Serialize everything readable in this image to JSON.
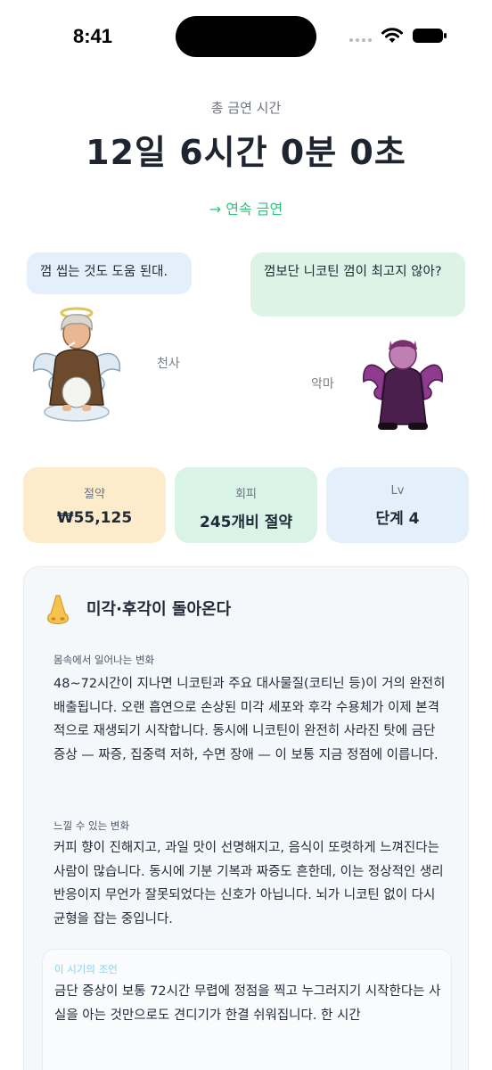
{
  "status_bar": {
    "time": "8:41"
  },
  "header": {
    "total_label": "총 금연 시간",
    "total_time": "12일 6시간 0분 0초",
    "streak_link": "→ 연속 금연"
  },
  "characters": {
    "angel": {
      "message": "껌 씹는 것도 도움 된대.",
      "label": "천사"
    },
    "devil": {
      "message": "껌보단 니코틴 껌이 최고지 않아?",
      "label": "악마"
    }
  },
  "stats": [
    {
      "title": "절약",
      "value": "₩55,125"
    },
    {
      "title": "회피",
      "value": "245개비 절약"
    },
    {
      "title": "Lv",
      "value": "단계 4"
    }
  ],
  "info": {
    "icon": "nose-icon",
    "title": "미각·후각이 돌아온다",
    "body_label": "몸속에서 일어나는 변화",
    "body_text": "48~72시간이 지나면 니코틴과 주요 대사물질(코티닌 등)이 거의 완전히 배출됩니다. 오랜 흡연으로 손상된 미각 세포와 후각 수용체가 이제 본격적으로 재생되기 시작합니다. 동시에 니코틴이 완전히 사라진 탓에 금단 증상 — 짜증, 집중력 저하, 수면 장애 — 이 보통 지금 정점에 이릅니다.",
    "feel_label": "느낄 수 있는 변화",
    "feel_text": "커피 향이 진해지고, 과일 맛이 선명해지고, 음식이 또렷하게 느껴진다는 사람이 많습니다. 동시에 기분 기복과 짜증도 흔한데, 이는 정상적인 생리 반응이지 무언가 잘못되었다는 신호가 아닙니다. 뇌가 니코틴 없이 다시 균형을 잡는 중입니다.",
    "advice_label": "이 시기의 조언",
    "advice_text": "금단 증상이 보통 72시간 무렵에 정점을 찍고 누그러지기 시작한다는 사실을 아는 것만으로도 견디기가 한결 쉬워집니다. 한 시간"
  },
  "colors": {
    "accent_green": "#34c27f",
    "saved_card": "#fdeccb",
    "avoid_card": "#daf3e7",
    "level_card": "#e3f0fb"
  }
}
